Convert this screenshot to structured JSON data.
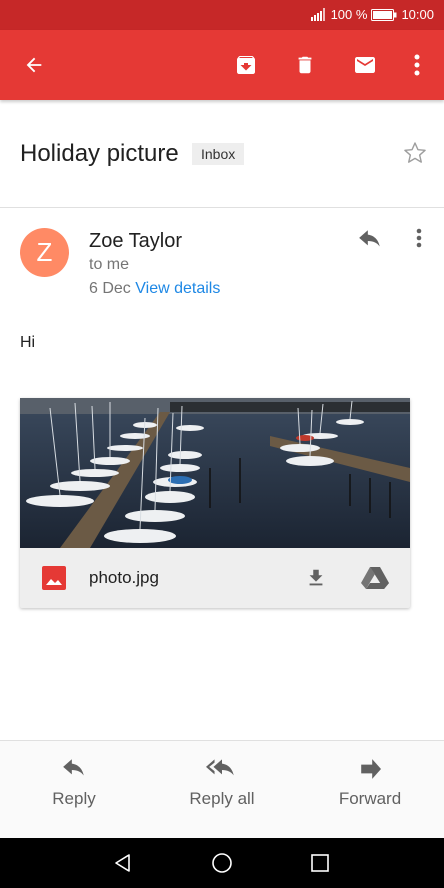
{
  "status_bar": {
    "battery": "100 %",
    "time": "10:00"
  },
  "toolbar": {
    "back_icon": "arrow-back-icon",
    "archive_icon": "archive-icon",
    "delete_icon": "trash-icon",
    "mark_unread_icon": "mail-icon",
    "more_icon": "more-vert-icon"
  },
  "message": {
    "subject": "Holiday picture",
    "label": "Inbox",
    "sender_initial": "Z",
    "sender_name": "Zoe Taylor",
    "recipient": "to me",
    "date": "6 Dec",
    "view_details": "View details",
    "body": "Hi"
  },
  "attachment": {
    "filename": "photo.jpg"
  },
  "actions": {
    "reply": "Reply",
    "reply_all": "Reply all",
    "forward": "Forward"
  },
  "colors": {
    "app_bar": "#e53935",
    "status_bar": "#c62828",
    "avatar": "#ff8a65",
    "link": "#1e88e5"
  }
}
